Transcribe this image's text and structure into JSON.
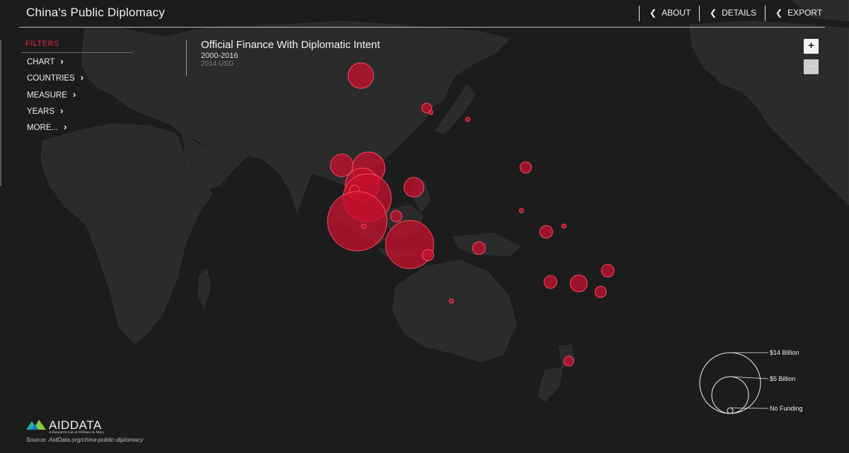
{
  "app": {
    "title": "China's Public Diplomacy"
  },
  "nav": [
    {
      "label": "ABOUT"
    },
    {
      "label": "DETAILS"
    },
    {
      "label": "EXPORT"
    }
  ],
  "filters": {
    "title": "FILTERS",
    "items": [
      {
        "label": "CHART"
      },
      {
        "label": "COUNTRIES"
      },
      {
        "label": "MEASURE"
      },
      {
        "label": "YEARS"
      },
      {
        "label": "MORE..."
      }
    ]
  },
  "map": {
    "title": "Official Finance With Diplomatic Intent",
    "years": "2000-2016",
    "unit": "2014 USD"
  },
  "zoom": {
    "in_label": "+",
    "out_label": "–"
  },
  "legend": {
    "items": [
      {
        "label": "$14 Billion",
        "value_billion": 14
      },
      {
        "label": "$5 Billion",
        "value_billion": 5
      },
      {
        "label": "No Funding",
        "value_billion": 0
      }
    ]
  },
  "footer": {
    "logo_text": "AIDDATA",
    "logo_sub": "A Research Lab at William & Mary",
    "source_prefix": "Source: ",
    "source_link": "AidData.org/china-public-diplomacy"
  },
  "colors": {
    "accent": "#e2283a",
    "bubble": "#c8102e",
    "land": "#2b2b2c",
    "ocean": "#1c1c1d"
  }
}
